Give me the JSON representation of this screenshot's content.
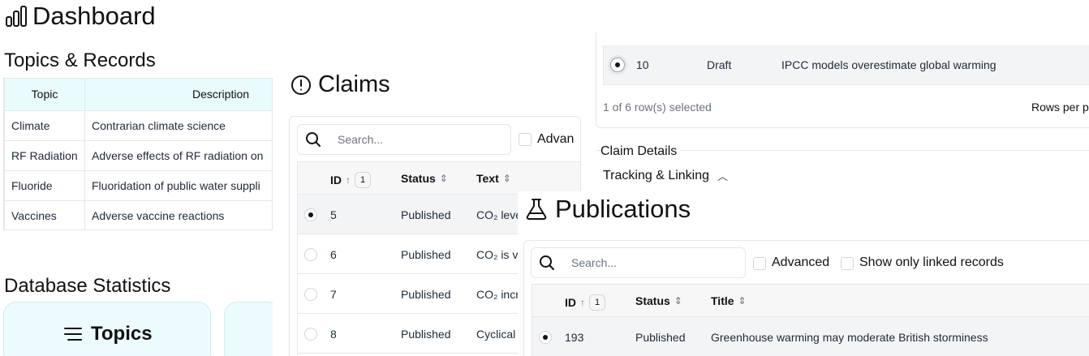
{
  "dashboard": {
    "title": "Dashboard",
    "icon": "bar-chart-icon"
  },
  "topics": {
    "heading": "Topics & Records",
    "columns": [
      "Topic",
      "Description"
    ],
    "rows": [
      {
        "topic": "Climate",
        "description": "Contrarian climate science"
      },
      {
        "topic": "RF Radiation",
        "description": "Adverse effects of RF radiation on"
      },
      {
        "topic": "Fluoride",
        "description": "Fluoridation of public water suppli"
      },
      {
        "topic": "Vaccines",
        "description": "Adverse vaccine reactions"
      }
    ]
  },
  "stats": {
    "heading": "Database Statistics",
    "cards": [
      {
        "label": "Topics",
        "icon": "list-icon"
      }
    ]
  },
  "claims": {
    "title": "Claims",
    "icon": "alert-circle-icon",
    "search_placeholder": "Search...",
    "advanced_label": "Advan",
    "columns": {
      "id": "ID",
      "id_sort_index": "1",
      "status": "Status",
      "text": "Text"
    },
    "rows": [
      {
        "id": "5",
        "status": "Published",
        "text": "CO₂ leve",
        "selected": true
      },
      {
        "id": "6",
        "status": "Published",
        "text": "CO₂ is v",
        "selected": false
      },
      {
        "id": "7",
        "status": "Published",
        "text": "CO₂ incr",
        "selected": false
      },
      {
        "id": "8",
        "status": "Published",
        "text": "Cyclical",
        "selected": false
      }
    ],
    "top_row": {
      "id": "10",
      "status": "Draft",
      "text": "IPCC models overestimate global warming",
      "selected": true
    },
    "selection_count": "1 of 6 row(s) selected",
    "rows_per_page_label": "Rows per p",
    "details_label": "Claim Details",
    "tracking_label": "Tracking & Linking"
  },
  "publications": {
    "title": "Publications",
    "icon": "flask-icon",
    "search_placeholder": "Search...",
    "advanced_label": "Advanced",
    "linked_label": "Show only linked records",
    "columns": {
      "id": "ID",
      "id_sort_index": "1",
      "status": "Status",
      "title": "Title"
    },
    "rows": [
      {
        "id": "193",
        "status": "Published",
        "title": "Greenhouse warming may moderate British storminess",
        "selected": true
      }
    ]
  }
}
